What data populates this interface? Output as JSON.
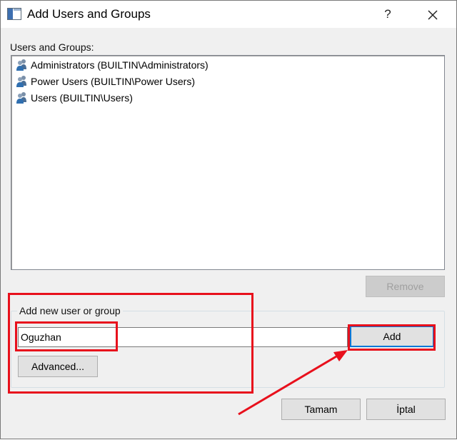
{
  "window": {
    "title": "Add Users and Groups",
    "help_label": "?"
  },
  "list": {
    "label": "Users and Groups:",
    "items": [
      {
        "label": "Administrators (BUILTIN\\Administrators)",
        "icon": "users-group-icon"
      },
      {
        "label": "Power Users (BUILTIN\\Power Users)",
        "icon": "users-group-icon"
      },
      {
        "label": "Users (BUILTIN\\Users)",
        "icon": "users-group-icon"
      }
    ]
  },
  "buttons": {
    "remove": "Remove",
    "add": "Add",
    "advanced": "Advanced...",
    "ok": "Tamam",
    "cancel": "İptal"
  },
  "add_group": {
    "legend": "Add new user or group",
    "input_value": "Oguzhan"
  },
  "annotations": {
    "highlight_color": "#e8101c"
  }
}
